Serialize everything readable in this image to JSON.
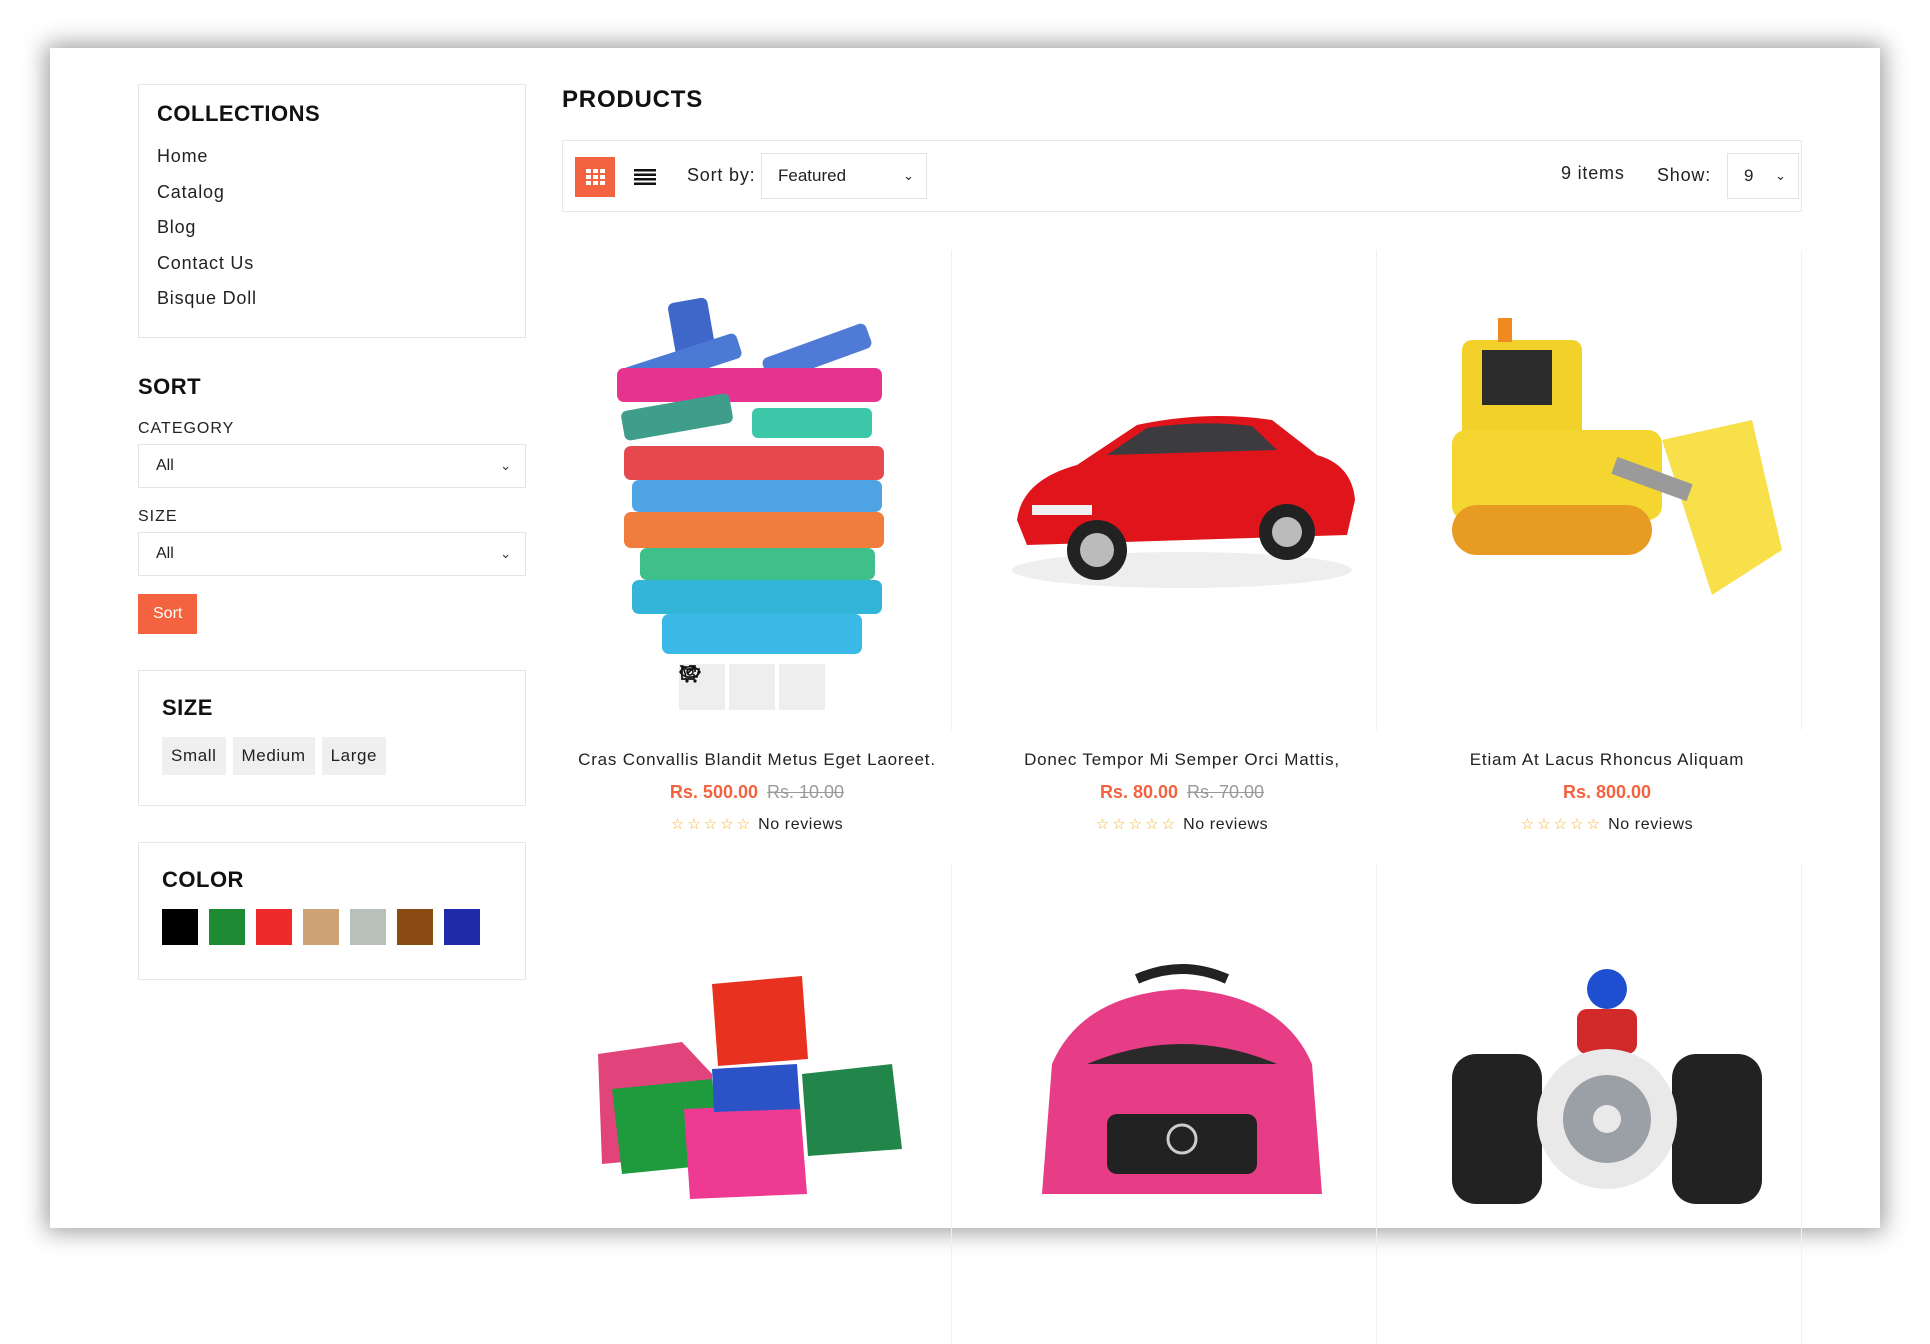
{
  "sidebar": {
    "collections": {
      "title": "COLLECTIONS",
      "items": [
        "Home",
        "Catalog",
        "Blog",
        "Contact Us",
        "Bisque Doll"
      ]
    },
    "sort": {
      "title": "SORT",
      "category_label": "CATEGORY",
      "category_value": "All",
      "size_label": "SIZE",
      "size_value": "All",
      "button_label": "Sort"
    },
    "size_filter": {
      "title": "SIZE",
      "options": [
        "Small",
        "Medium",
        "Large"
      ]
    },
    "color_filter": {
      "title": "COLOR",
      "swatches": [
        "#000000",
        "#1e8a33",
        "#ee2a2a",
        "#cda274",
        "#b9bfba",
        "#8a4b12",
        "#1f2aa8"
      ]
    }
  },
  "main": {
    "title": "PRODUCTS",
    "toolbar": {
      "sort_label": "Sort by:",
      "sort_value": "Featured",
      "items_count": "9 items",
      "show_label": "Show:",
      "show_value": "9"
    },
    "products": [
      {
        "name": "Cras Convallis Blandit Metus Eget Laoreet.",
        "price": "Rs. 500.00",
        "old_price": "Rs. 10.00",
        "reviews": "No reviews",
        "rating": 0,
        "image": "stacked-chalk-sticks"
      },
      {
        "name": "Donec Tempor Mi Semper Orci Mattis,",
        "price": "Rs. 80.00",
        "old_price": "Rs. 70.00",
        "reviews": "No reviews",
        "rating": 0,
        "image": "red-toy-car"
      },
      {
        "name": "Etiam At Lacus Rhoncus Aliquam",
        "price": "Rs. 800.00",
        "old_price": "",
        "reviews": "No reviews",
        "rating": 0,
        "image": "yellow-toy-bulldozer"
      },
      {
        "name": "",
        "price": "",
        "old_price": "",
        "reviews": "",
        "image": "wooden-blocks"
      },
      {
        "name": "",
        "price": "",
        "old_price": "",
        "reviews": "",
        "image": "pink-ride-on-car"
      },
      {
        "name": "",
        "price": "",
        "old_price": "",
        "reviews": "",
        "image": "rc-stunt-vehicle"
      }
    ]
  },
  "icons": {
    "grid_view": "grid-icon",
    "list_view": "list-icon",
    "cart": "cart-icon",
    "quick_view": "eye-icon",
    "open": "external-link-icon",
    "chevron": "chevron-down-icon"
  },
  "colors": {
    "accent": "#f3633f"
  }
}
